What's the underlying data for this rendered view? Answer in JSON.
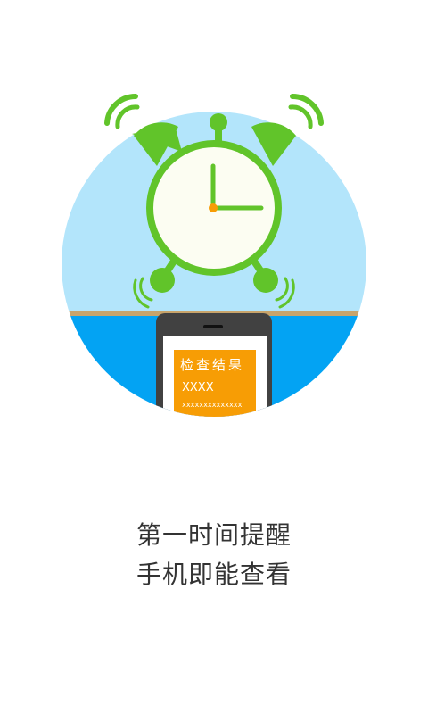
{
  "phone_screen": {
    "card_title": "检查结果",
    "card_placeholder_short": "XXXX",
    "card_placeholder_long": "xxxxxxxxxxxxxx"
  },
  "caption": {
    "line1": "第一时间提醒",
    "line2": "手机即能查看"
  },
  "colors": {
    "sky": "#b3e5fb",
    "table": "#03a3f3",
    "table_edge": "#c8a46b",
    "clock_green": "#61c42a",
    "clock_face": "#fcfdf2",
    "phone_body": "#414141",
    "card_orange": "#f79d05",
    "caption_text": "#333333"
  }
}
